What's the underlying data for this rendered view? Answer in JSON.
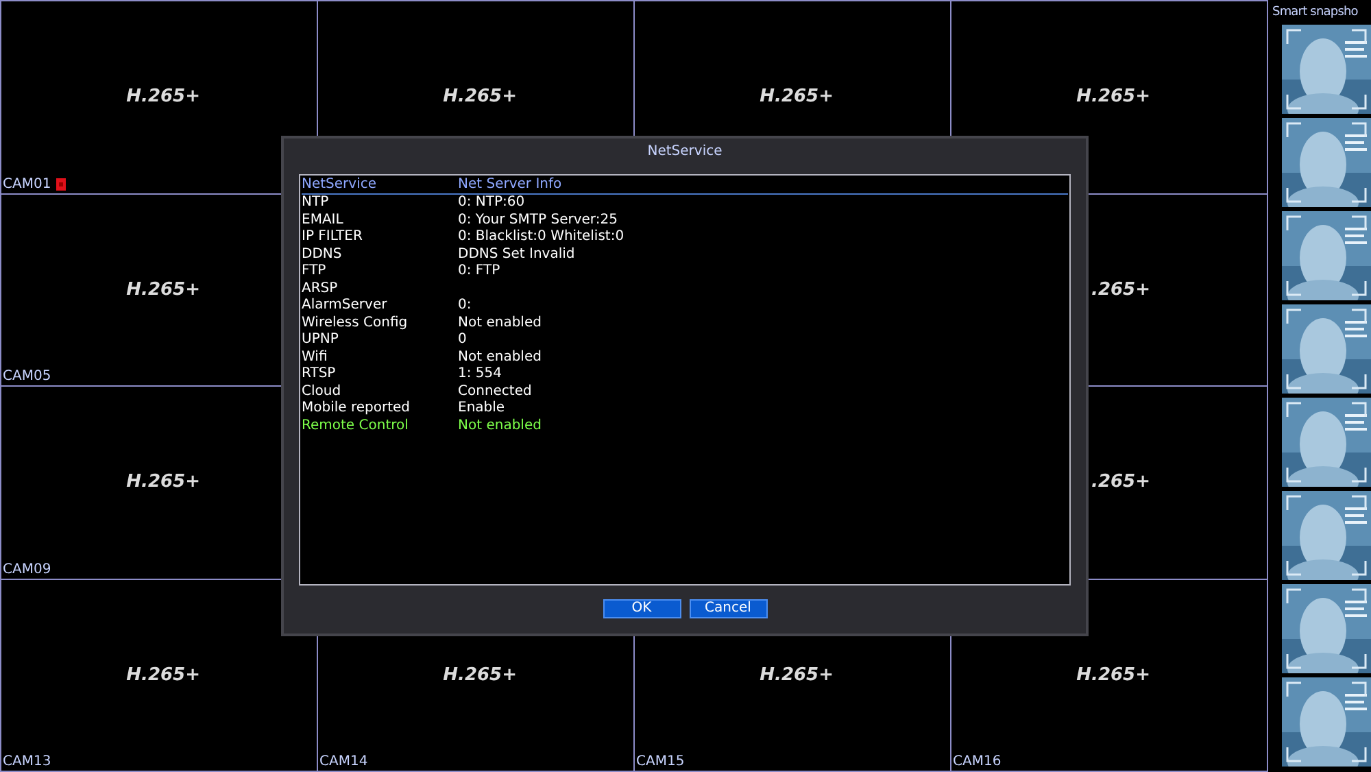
{
  "cells": [
    {
      "codec": "H.265+",
      "label": "CAM01",
      "recording": true
    },
    {
      "codec": "H.265+"
    },
    {
      "codec": "H.265+"
    },
    {
      "codec": "H.265+"
    },
    {
      "codec": "H.265+",
      "label": "CAM05"
    },
    {},
    {},
    {
      "codec": ".265+"
    },
    {
      "codec": "H.265+",
      "label": "CAM09"
    },
    {},
    {},
    {
      "codec": ".265+"
    },
    {
      "codec": "H.265+",
      "label": "CAM13"
    },
    {
      "codec": "H.265+",
      "label": "CAM14"
    },
    {
      "codec": "H.265+",
      "label": "CAM15"
    },
    {
      "codec": "H.265+",
      "label": "CAM16"
    }
  ],
  "snapshot_panel": {
    "title": "Smart snapsho"
  },
  "dialog": {
    "title": "NetService",
    "columns": [
      "NetService",
      "Net Server Info"
    ],
    "rows": [
      {
        "service": "NTP",
        "info": "0: NTP:60",
        "selected": false
      },
      {
        "service": "EMAIL",
        "info": "0: Your SMTP Server:25",
        "selected": false
      },
      {
        "service": "IP FILTER",
        "info": "0: Blacklist:0 Whitelist:0",
        "selected": false
      },
      {
        "service": "DDNS",
        "info": "DDNS Set Invalid",
        "selected": false
      },
      {
        "service": "FTP",
        "info": "0: FTP",
        "selected": false
      },
      {
        "service": "ARSP",
        "selected": false
      },
      {
        "service": "AlarmServer",
        "info": "0:",
        "selected": false
      },
      {
        "service": "Wireless Config",
        "info": "Not enabled",
        "selected": false
      },
      {
        "service": "UPNP",
        "info": "0",
        "selected": false
      },
      {
        "service": "Wifi",
        "info": "Not enabled",
        "selected": false
      },
      {
        "service": "RTSP",
        "info": "1: 554",
        "selected": false
      },
      {
        "service": "Cloud",
        "info": "Connected",
        "selected": false
      },
      {
        "service": "Mobile reported",
        "info": "Enable",
        "selected": false
      },
      {
        "service": "Remote Control",
        "info": "Not enabled",
        "selected": true
      }
    ],
    "buttons": [
      "OK",
      "Cancel"
    ]
  }
}
